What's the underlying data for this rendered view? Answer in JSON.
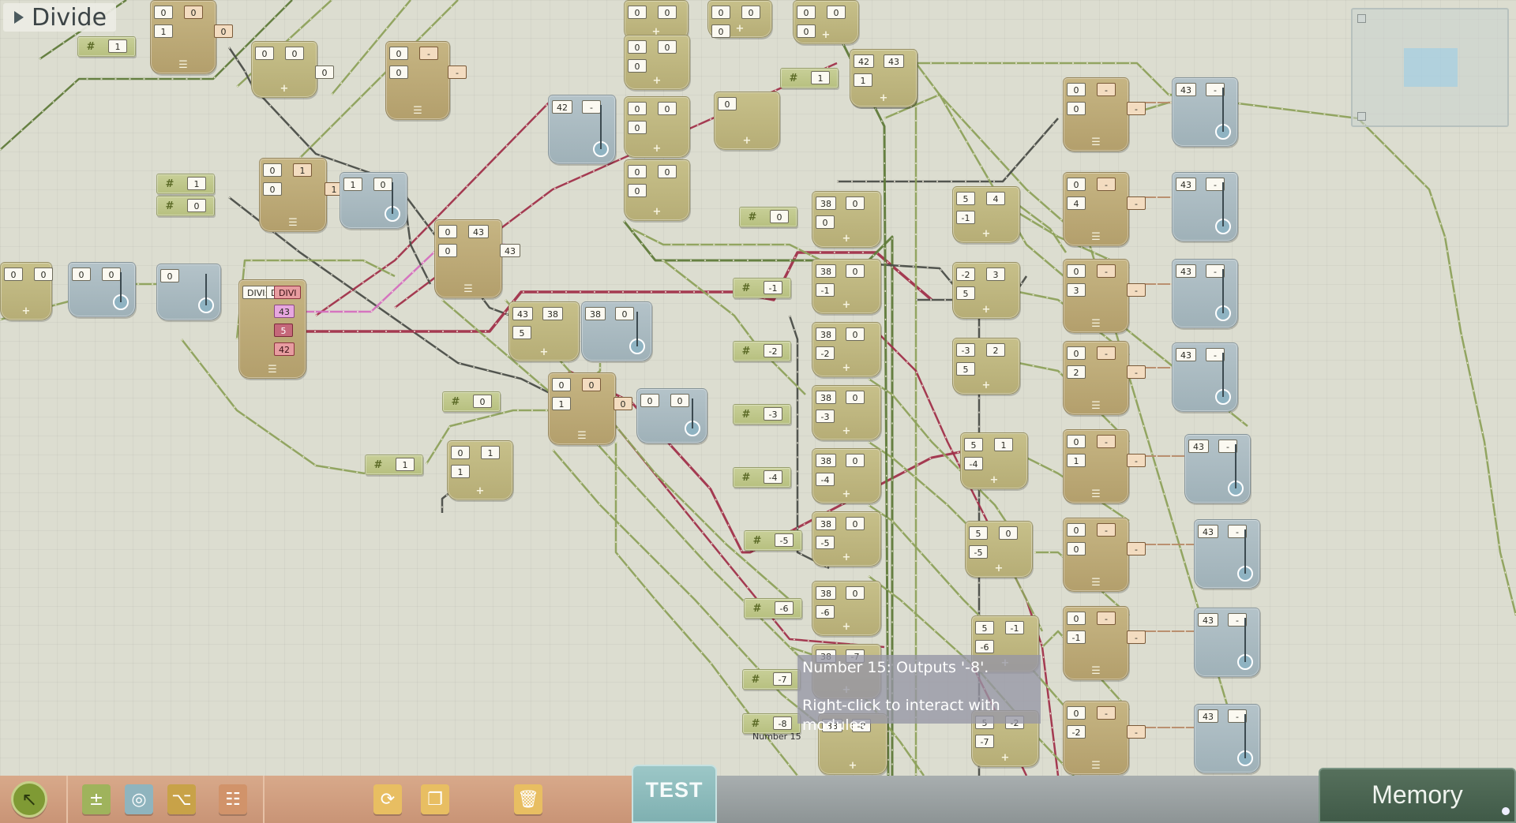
{
  "title_bar": {
    "title": "Divide"
  },
  "tooltip": {
    "line1": "Number 15: Outputs '-8'.",
    "line2": "Right-click to interact with modules."
  },
  "hover_label": "Number 15",
  "toolbar": {
    "test_label": "TEST",
    "memory_label": "Memory",
    "icons": [
      "pointer-icon",
      "arithmetic-icon",
      "display-icon",
      "logic-icon",
      "network-icon",
      "loop-icon",
      "copy-icon",
      "trash-icon"
    ]
  },
  "colors": {
    "wire_green": "#8da15b",
    "wire_dark_green": "#5f7a3a",
    "wire_red": "#a0304a",
    "wire_pink": "#d46fbe",
    "wire_gray": "#4a4d48",
    "wire_tan": "#b78b6a",
    "toolbar_strip": "#d3a283",
    "test_tab": "#8dbcbc",
    "memory_tab": "#4b6551"
  },
  "modules": [
    {
      "kind": "logic",
      "ports": [
        {
          "t": "0"
        },
        {
          "t": "0",
          "o": 1
        },
        {
          "t": "1"
        }
      ],
      "extra": [
        {
          "t": "0",
          "o": 1
        }
      ]
    },
    {
      "kind": "const",
      "ports": [
        {
          "t": "1"
        }
      ]
    },
    {
      "kind": "calc",
      "ports": [
        {
          "t": "0"
        },
        {
          "t": "0"
        }
      ],
      "extra": [
        {
          "t": "0"
        }
      ]
    },
    {
      "kind": "logic",
      "ports": [
        {
          "t": "0"
        },
        {
          "t": "-",
          "o": 1
        },
        {
          "t": "0"
        }
      ],
      "extra": [
        {
          "t": "-",
          "o": 1
        }
      ]
    },
    {
      "kind": "disp",
      "ports": [
        {
          "t": "42"
        },
        {
          "t": "-"
        }
      ]
    },
    {
      "kind": "const",
      "ports": [
        {
          "t": "1"
        }
      ]
    },
    {
      "kind": "const",
      "ports": [
        {
          "t": "0"
        }
      ]
    },
    {
      "kind": "logic",
      "ports": [
        {
          "t": "0"
        },
        {
          "t": "1",
          "o": 1
        },
        {
          "t": "0"
        }
      ],
      "extra": [
        {
          "t": "1",
          "o": 1
        }
      ]
    },
    {
      "kind": "disp",
      "ports": [
        {
          "t": "1"
        },
        {
          "t": "0"
        }
      ]
    },
    {
      "kind": "logic",
      "ports": [
        {
          "t": "0"
        },
        {
          "t": "43"
        },
        {
          "t": "0"
        }
      ],
      "extra": [
        {
          "t": "43"
        }
      ]
    },
    {
      "kind": "calc",
      "ports": [
        {
          "t": "0"
        },
        {
          "t": "0"
        }
      ]
    },
    {
      "kind": "disp",
      "ports": [
        {
          "t": "0"
        },
        {
          "t": "0"
        }
      ]
    },
    {
      "kind": "disp",
      "ports": [
        {
          "t": "0"
        }
      ]
    },
    {
      "kind": "logic",
      "ports": [
        {
          "t": "DIVI:"
        },
        {
          "t": "DIVI:"
        },
        {
          "t": "DIVI"
        },
        {
          "t": "43"
        },
        {
          "t": "5"
        },
        {
          "t": "42"
        }
      ]
    },
    {
      "kind": "calc",
      "ports": [
        {
          "t": "43"
        },
        {
          "t": "38"
        },
        {
          "t": "5"
        }
      ]
    },
    {
      "kind": "disp",
      "ports": [
        {
          "t": "38"
        },
        {
          "t": "0"
        }
      ]
    },
    {
      "kind": "const",
      "ports": [
        {
          "t": "0"
        }
      ]
    },
    {
      "kind": "logic",
      "ports": [
        {
          "t": "0"
        },
        {
          "t": "0",
          "o": 1
        },
        {
          "t": "1"
        }
      ],
      "extra": [
        {
          "t": "0",
          "o": 1
        }
      ]
    },
    {
      "kind": "disp",
      "ports": [
        {
          "t": "0"
        },
        {
          "t": "0"
        }
      ]
    },
    {
      "kind": "const",
      "ports": [
        {
          "t": "1"
        }
      ]
    },
    {
      "kind": "calc",
      "ports": [
        {
          "t": "0"
        },
        {
          "t": "1"
        },
        {
          "t": "1"
        }
      ]
    },
    {
      "kind": "calc",
      "ports": [
        {
          "t": "0"
        },
        {
          "t": "0"
        }
      ]
    },
    {
      "kind": "calc",
      "ports": [
        {
          "t": "0"
        },
        {
          "t": "0"
        },
        {
          "t": "0"
        }
      ]
    },
    {
      "kind": "calc",
      "ports": [
        {
          "t": "0"
        },
        {
          "t": "0"
        },
        {
          "t": "0"
        }
      ]
    },
    {
      "kind": "calc",
      "ports": [
        {
          "t": "0"
        },
        {
          "t": "0"
        },
        {
          "t": "0"
        }
      ]
    },
    {
      "kind": "calc",
      "ports": [
        {
          "t": "0"
        },
        {
          "t": "0"
        },
        {
          "t": "0"
        }
      ]
    },
    {
      "kind": "calc",
      "ports": [
        {
          "t": "0"
        },
        {
          "t": "0"
        },
        {
          "t": "0"
        }
      ]
    },
    {
      "kind": "calc",
      "ports": [
        {
          "t": "0"
        }
      ]
    },
    {
      "kind": "calc",
      "ports": [
        {
          "t": "0"
        },
        {
          "t": "0"
        },
        {
          "t": "0"
        }
      ]
    },
    {
      "kind": "const",
      "ports": [
        {
          "t": "1"
        }
      ]
    },
    {
      "kind": "calc",
      "ports": [
        {
          "t": "42"
        },
        {
          "t": "43"
        },
        {
          "t": "1"
        }
      ]
    },
    {
      "kind": "const",
      "ports": [
        {
          "t": "0"
        }
      ]
    },
    {
      "kind": "calc",
      "ports": [
        {
          "t": "38"
        },
        {
          "t": "0"
        },
        {
          "t": "0"
        }
      ]
    },
    {
      "kind": "const",
      "ports": [
        {
          "t": "-1"
        }
      ]
    },
    {
      "kind": "calc",
      "ports": [
        {
          "t": "38"
        },
        {
          "t": "0"
        },
        {
          "t": "-1"
        }
      ]
    },
    {
      "kind": "const",
      "ports": [
        {
          "t": "-2"
        }
      ]
    },
    {
      "kind": "calc",
      "ports": [
        {
          "t": "38"
        },
        {
          "t": "0"
        },
        {
          "t": "-2"
        }
      ]
    },
    {
      "kind": "const",
      "ports": [
        {
          "t": "-3"
        }
      ]
    },
    {
      "kind": "calc",
      "ports": [
        {
          "t": "38"
        },
        {
          "t": "0"
        },
        {
          "t": "-3"
        }
      ]
    },
    {
      "kind": "const",
      "ports": [
        {
          "t": "-4"
        }
      ]
    },
    {
      "kind": "calc",
      "ports": [
        {
          "t": "38"
        },
        {
          "t": "0"
        },
        {
          "t": "-4"
        }
      ]
    },
    {
      "kind": "const",
      "ports": [
        {
          "t": "-5"
        }
      ]
    },
    {
      "kind": "calc",
      "ports": [
        {
          "t": "38"
        },
        {
          "t": "0"
        },
        {
          "t": "-5"
        }
      ]
    },
    {
      "kind": "const",
      "ports": [
        {
          "t": "-6"
        }
      ]
    },
    {
      "kind": "calc",
      "ports": [
        {
          "t": "38"
        },
        {
          "t": "0"
        },
        {
          "t": "-6"
        }
      ]
    },
    {
      "kind": "const",
      "ports": [
        {
          "t": "-7"
        }
      ]
    },
    {
      "kind": "calc",
      "ports": [
        {
          "t": "38"
        },
        {
          "t": "-7"
        }
      ]
    },
    {
      "kind": "const",
      "ports": [
        {
          "t": "-8"
        }
      ]
    },
    {
      "kind": "calc",
      "ports": [
        {
          "t": "38"
        },
        {
          "t": "-8"
        }
      ]
    },
    {
      "kind": "calc",
      "ports": [
        {
          "t": "5"
        },
        {
          "t": "4"
        },
        {
          "t": "-1"
        }
      ]
    },
    {
      "kind": "calc",
      "ports": [
        {
          "t": "-2"
        },
        {
          "t": "3"
        },
        {
          "t": "5"
        }
      ]
    },
    {
      "kind": "calc",
      "ports": [
        {
          "t": "-3"
        },
        {
          "t": "2"
        },
        {
          "t": "5"
        }
      ]
    },
    {
      "kind": "calc",
      "ports": [
        {
          "t": "5"
        },
        {
          "t": "1"
        },
        {
          "t": "-4"
        }
      ]
    },
    {
      "kind": "calc",
      "ports": [
        {
          "t": "5"
        },
        {
          "t": "0"
        },
        {
          "t": "-5"
        }
      ]
    },
    {
      "kind": "calc",
      "ports": [
        {
          "t": "5"
        },
        {
          "t": "-1"
        },
        {
          "t": "-6"
        }
      ]
    },
    {
      "kind": "calc",
      "ports": [
        {
          "t": "5"
        },
        {
          "t": "-2"
        },
        {
          "t": "-7"
        }
      ]
    },
    {
      "kind": "logic",
      "ports": [
        {
          "t": "0"
        },
        {
          "t": "-",
          "o": 1
        },
        {
          "t": "0"
        }
      ],
      "extra": [
        {
          "t": "-",
          "o": 1
        }
      ]
    },
    {
      "kind": "logic",
      "ports": [
        {
          "t": "0"
        },
        {
          "t": "-",
          "o": 1
        },
        {
          "t": "4"
        }
      ],
      "extra": [
        {
          "t": "-",
          "o": 1
        }
      ]
    },
    {
      "kind": "logic",
      "ports": [
        {
          "t": "0"
        },
        {
          "t": "-",
          "o": 1
        },
        {
          "t": "3"
        }
      ],
      "extra": [
        {
          "t": "-",
          "o": 1
        }
      ]
    },
    {
      "kind": "logic",
      "ports": [
        {
          "t": "0"
        },
        {
          "t": "-",
          "o": 1
        },
        {
          "t": "2"
        }
      ],
      "extra": [
        {
          "t": "-",
          "o": 1
        }
      ]
    },
    {
      "kind": "logic",
      "ports": [
        {
          "t": "0"
        },
        {
          "t": "-",
          "o": 1
        },
        {
          "t": "1"
        }
      ],
      "extra": [
        {
          "t": "-",
          "o": 1
        }
      ]
    },
    {
      "kind": "logic",
      "ports": [
        {
          "t": "0"
        },
        {
          "t": "-",
          "o": 1
        },
        {
          "t": "0"
        }
      ],
      "extra": [
        {
          "t": "-",
          "o": 1
        }
      ]
    },
    {
      "kind": "logic",
      "ports": [
        {
          "t": "0"
        },
        {
          "t": "-",
          "o": 1
        },
        {
          "t": "-1"
        }
      ],
      "extra": [
        {
          "t": "-",
          "o": 1
        }
      ]
    },
    {
      "kind": "logic",
      "ports": [
        {
          "t": "0"
        },
        {
          "t": "-",
          "o": 1
        },
        {
          "t": "-2"
        }
      ],
      "extra": [
        {
          "t": "-",
          "o": 1
        }
      ]
    },
    {
      "kind": "disp",
      "ports": [
        {
          "t": "43"
        },
        {
          "t": "-"
        }
      ]
    },
    {
      "kind": "disp",
      "ports": [
        {
          "t": "43"
        },
        {
          "t": "-"
        }
      ]
    },
    {
      "kind": "disp",
      "ports": [
        {
          "t": "43"
        },
        {
          "t": "-"
        }
      ]
    },
    {
      "kind": "disp",
      "ports": [
        {
          "t": "43"
        },
        {
          "t": "-"
        }
      ]
    },
    {
      "kind": "disp",
      "ports": [
        {
          "t": "43"
        },
        {
          "t": "-"
        }
      ]
    },
    {
      "kind": "disp",
      "ports": [
        {
          "t": "43"
        },
        {
          "t": "-"
        }
      ]
    },
    {
      "kind": "disp",
      "ports": [
        {
          "t": "43"
        },
        {
          "t": "-"
        }
      ]
    },
    {
      "kind": "disp",
      "ports": [
        {
          "t": "43"
        },
        {
          "t": "-"
        }
      ]
    }
  ]
}
